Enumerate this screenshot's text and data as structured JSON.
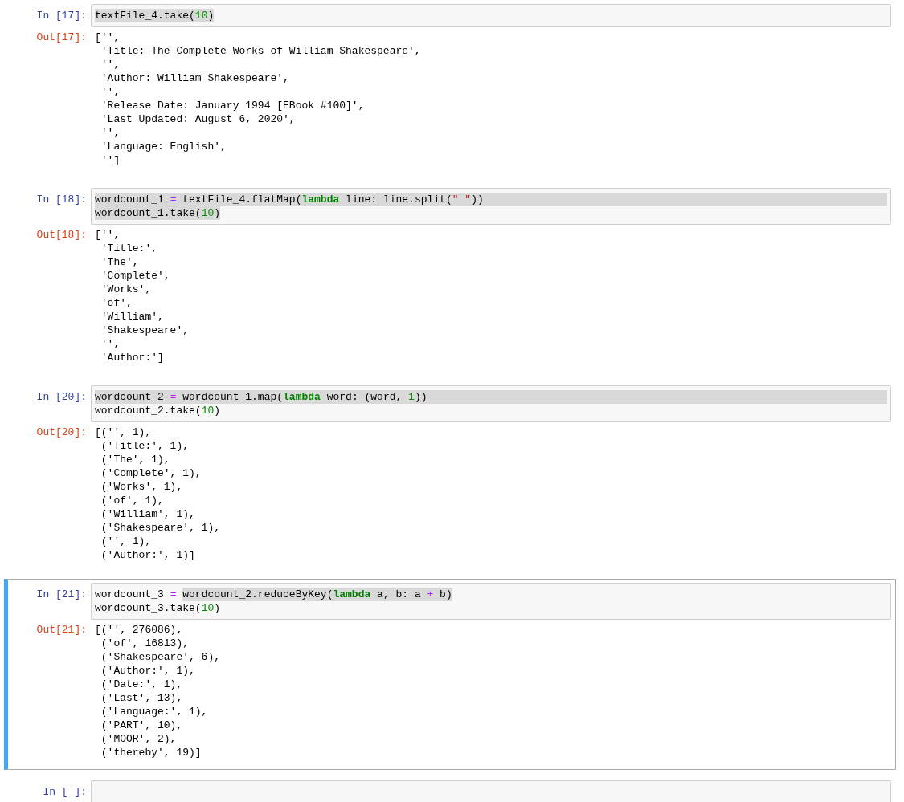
{
  "cells": [
    {
      "prompt": "In [17]:",
      "selected": false,
      "code": [
        {
          "highlight_full_width": false,
          "tokens": [
            {
              "text": "textFile_4.take(",
              "kind": "name",
              "highlighted": true
            },
            {
              "text": "10",
              "kind": "number",
              "highlighted": true
            },
            {
              "text": ")",
              "kind": "name",
              "highlighted": true
            }
          ]
        }
      ],
      "output_prompt": "Out[17]:",
      "output": [
        "['',",
        " 'Title: The Complete Works of William Shakespeare',",
        " '',",
        " 'Author: William Shakespeare',",
        " '',",
        " 'Release Date: January 1994 [EBook #100]',",
        " 'Last Updated: August 6, 2020',",
        " '',",
        " 'Language: English',",
        " '']"
      ]
    },
    {
      "prompt": "In [18]:",
      "selected": false,
      "code": [
        {
          "highlight_full_width": true,
          "tokens": [
            {
              "text": "wordcount_1 ",
              "kind": "name",
              "highlighted": true
            },
            {
              "text": "=",
              "kind": "operator",
              "highlighted": true
            },
            {
              "text": " textFile_4.flatMap(",
              "kind": "name",
              "highlighted": true
            },
            {
              "text": "lambda",
              "kind": "keyword",
              "highlighted": true
            },
            {
              "text": " line: line.split(",
              "kind": "name",
              "highlighted": true
            },
            {
              "text": "\" \"",
              "kind": "string",
              "highlighted": true
            },
            {
              "text": "))",
              "kind": "name",
              "highlighted": true
            }
          ]
        },
        {
          "highlight_full_width": false,
          "tokens": [
            {
              "text": "wordcount_1.take(",
              "kind": "name",
              "highlighted": true
            },
            {
              "text": "10",
              "kind": "number",
              "highlighted": true
            },
            {
              "text": ")",
              "kind": "name",
              "highlighted": true
            }
          ]
        }
      ],
      "output_prompt": "Out[18]:",
      "output": [
        "['',",
        " 'Title:',",
        " 'The',",
        " 'Complete',",
        " 'Works',",
        " 'of',",
        " 'William',",
        " 'Shakespeare',",
        " '',",
        " 'Author:']"
      ]
    },
    {
      "prompt": "In [20]:",
      "selected": false,
      "code": [
        {
          "highlight_full_width": true,
          "tokens": [
            {
              "text": "wordcount_2 ",
              "kind": "name",
              "highlighted": true
            },
            {
              "text": "=",
              "kind": "operator",
              "highlighted": true
            },
            {
              "text": " wordcount_1.map(",
              "kind": "name",
              "highlighted": true
            },
            {
              "text": "lambda",
              "kind": "keyword",
              "highlighted": true
            },
            {
              "text": " word: (word, ",
              "kind": "name",
              "highlighted": true
            },
            {
              "text": "1",
              "kind": "number",
              "highlighted": true
            },
            {
              "text": "))",
              "kind": "name",
              "highlighted": true
            }
          ]
        },
        {
          "highlight_full_width": false,
          "tokens": [
            {
              "text": "wordcount_2.take(",
              "kind": "name",
              "highlighted": false
            },
            {
              "text": "10",
              "kind": "number",
              "highlighted": false
            },
            {
              "text": ")",
              "kind": "name",
              "highlighted": false
            }
          ]
        }
      ],
      "output_prompt": "Out[20]:",
      "output": [
        "[('', 1),",
        " ('Title:', 1),",
        " ('The', 1),",
        " ('Complete', 1),",
        " ('Works', 1),",
        " ('of', 1),",
        " ('William', 1),",
        " ('Shakespeare', 1),",
        " ('', 1),",
        " ('Author:', 1)]"
      ]
    },
    {
      "prompt": "In [21]:",
      "selected": true,
      "code": [
        {
          "highlight_full_width": false,
          "tokens": [
            {
              "text": "wordcount_3 ",
              "kind": "name",
              "highlighted": false
            },
            {
              "text": "= ",
              "kind": "operator",
              "highlighted": false
            },
            {
              "text": "wordcount_2.reduceByKey(",
              "kind": "name",
              "highlighted": true
            },
            {
              "text": "lambda",
              "kind": "keyword",
              "highlighted": true
            },
            {
              "text": " a, b: a ",
              "kind": "name",
              "highlighted": true
            },
            {
              "text": "+",
              "kind": "operator",
              "highlighted": true
            },
            {
              "text": " b)",
              "kind": "name",
              "highlighted": true
            }
          ]
        },
        {
          "highlight_full_width": false,
          "tokens": [
            {
              "text": "wordcount_3.take(",
              "kind": "name",
              "highlighted": false
            },
            {
              "text": "10",
              "kind": "number",
              "highlighted": false
            },
            {
              "text": ")",
              "kind": "name",
              "highlighted": false
            }
          ]
        }
      ],
      "output_prompt": "Out[21]:",
      "output": [
        "[('', 276086),",
        " ('of', 16813),",
        " ('Shakespeare', 6),",
        " ('Author:', 1),",
        " ('Date:', 1),",
        " ('Last', 13),",
        " ('Language:', 1),",
        " ('PART', 10),",
        " ('MOOR', 2),",
        " ('thereby', 19)]"
      ]
    },
    {
      "prompt": "In [ ]:",
      "selected": false
    }
  ]
}
